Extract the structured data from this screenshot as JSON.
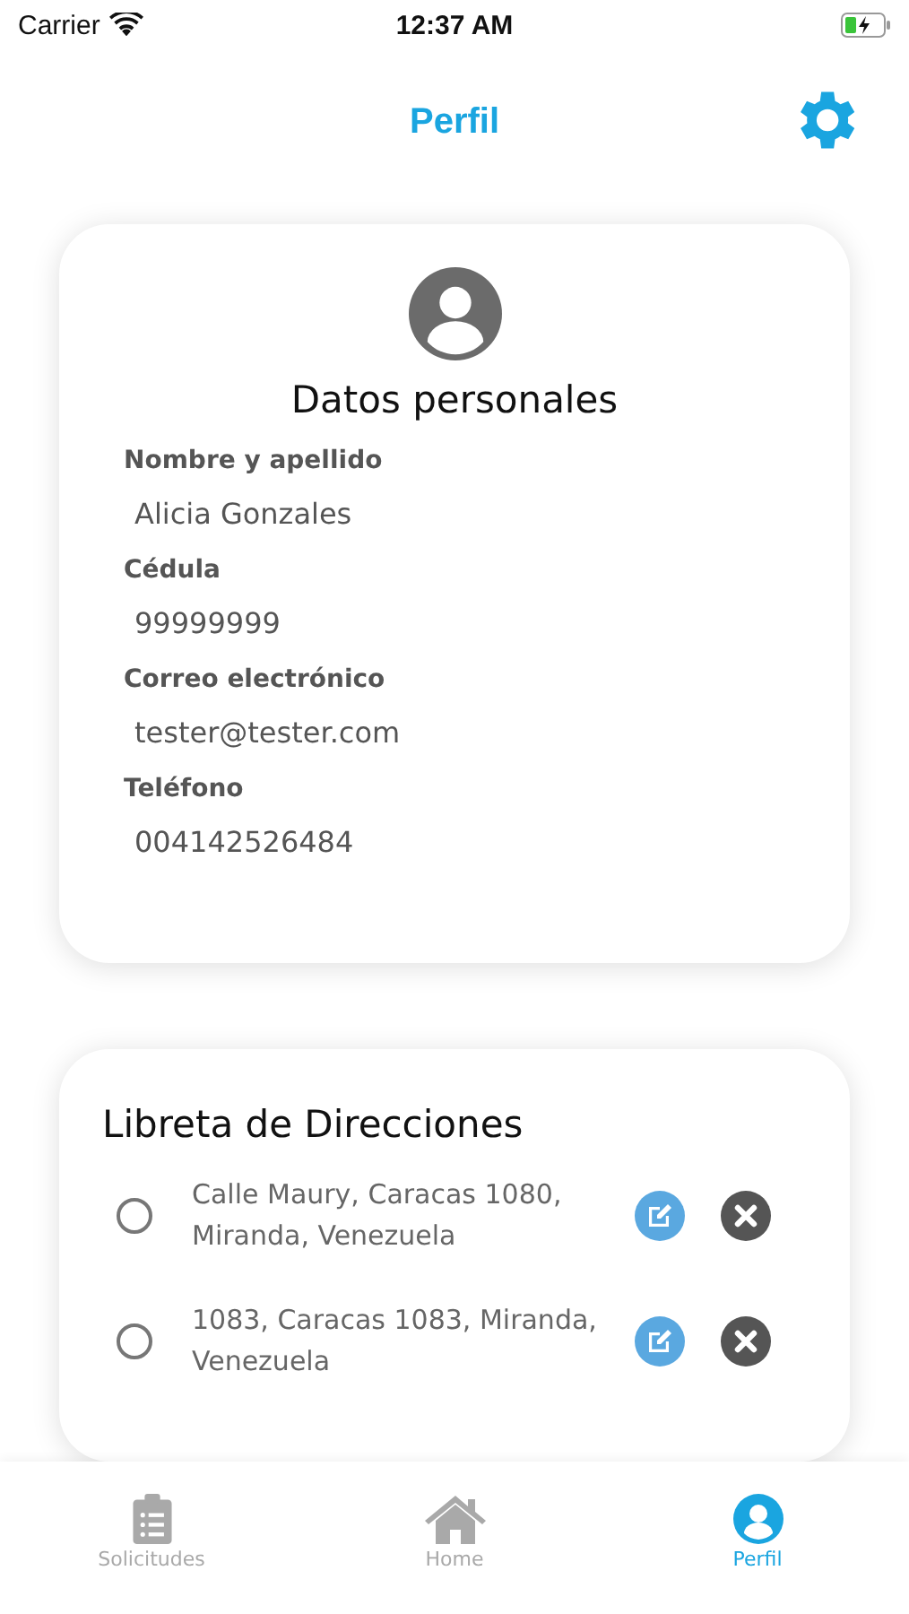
{
  "status_bar": {
    "carrier": "Carrier",
    "time": "12:37 AM"
  },
  "header": {
    "title": "Perfil"
  },
  "personal": {
    "title": "Datos personales",
    "fields": [
      {
        "label": "Nombre y apellido",
        "value": "Alicia Gonzales"
      },
      {
        "label": "Cédula",
        "value": "99999999"
      },
      {
        "label": "Correo electrónico",
        "value": "tester@tester.com"
      },
      {
        "label": "Teléfono",
        "value": "004142526484"
      }
    ]
  },
  "addresses": {
    "title": "Libreta de Direcciones",
    "items": [
      {
        "text": "Calle Maury, Caracas 1080, Miranda, Venezuela",
        "selected": false
      },
      {
        "text": "1083, Caracas 1083, Miranda, Venezuela",
        "selected": false
      }
    ]
  },
  "tabs": [
    {
      "label": "Solicitudes",
      "kind": "clipboard",
      "selected": false
    },
    {
      "label": "Home",
      "kind": "home",
      "selected": false
    },
    {
      "label": "Perfil",
      "kind": "person",
      "selected": true
    }
  ]
}
